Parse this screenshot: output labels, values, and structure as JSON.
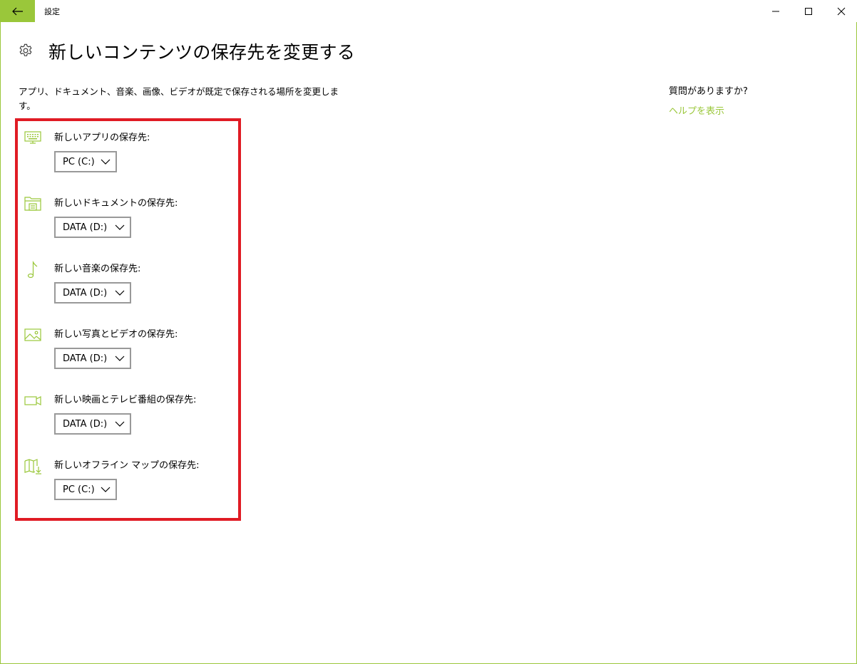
{
  "window": {
    "title": "設定",
    "accent_color": "#9ac73a",
    "highlight_color": "#e01b24"
  },
  "header": {
    "title": "新しいコンテンツの保存先を変更する",
    "icon": "gear-icon"
  },
  "description": "アプリ、ドキュメント、音楽、画像、ビデオが既定で保存される場所を変更します。",
  "side_panel": {
    "question": "質問がありますか?",
    "help_link": "ヘルプを表示"
  },
  "settings": [
    {
      "icon": "app-icon",
      "label": "新しいアプリの保存先:",
      "value": "PC (C:)"
    },
    {
      "icon": "document-icon",
      "label": "新しいドキュメントの保存先:",
      "value": "DATA (D:)"
    },
    {
      "icon": "music-note-icon",
      "label": "新しい音楽の保存先:",
      "value": "DATA (D:)"
    },
    {
      "icon": "photo-icon",
      "label": "新しい写真とビデオの保存先:",
      "value": "DATA (D:)"
    },
    {
      "icon": "video-camera-icon",
      "label": "新しい映画とテレビ番組の保存先:",
      "value": "DATA (D:)"
    },
    {
      "icon": "map-download-icon",
      "label": "新しいオフライン マップの保存先:",
      "value": "PC (C:)"
    }
  ]
}
